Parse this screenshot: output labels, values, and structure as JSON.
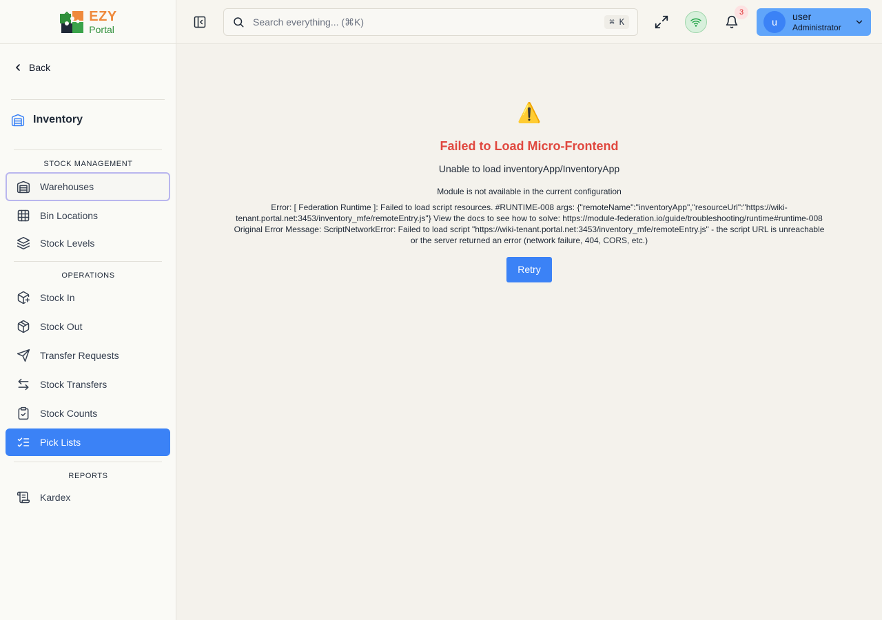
{
  "brand": {
    "line1": "EZY",
    "line2": "Portal"
  },
  "sidebar": {
    "back_label": "Back",
    "module_title": "Inventory",
    "sections": [
      {
        "header": "STOCK MANAGEMENT",
        "items": [
          {
            "label": "Warehouses",
            "icon": "warehouse-icon"
          },
          {
            "label": "Bin Locations",
            "icon": "grid-icon"
          },
          {
            "label": "Stock Levels",
            "icon": "layers-icon"
          }
        ]
      },
      {
        "header": "OPERATIONS",
        "items": [
          {
            "label": "Stock In",
            "icon": "package-plus-icon"
          },
          {
            "label": "Stock Out",
            "icon": "package-minus-icon"
          },
          {
            "label": "Transfer Requests",
            "icon": "send-icon"
          },
          {
            "label": "Stock Transfers",
            "icon": "arrows-left-right-icon"
          },
          {
            "label": "Stock Counts",
            "icon": "clipboard-check-icon"
          },
          {
            "label": "Pick Lists",
            "icon": "list-checks-icon"
          }
        ]
      },
      {
        "header": "REPORTS",
        "items": [
          {
            "label": "Kardex",
            "icon": "scroll-icon"
          }
        ]
      }
    ],
    "active_item": "Pick Lists",
    "focused_item": "Warehouses"
  },
  "header": {
    "search_placeholder": "Search everything... (⌘K)",
    "search_shortcut": "⌘ K",
    "notification_count": "3",
    "user": {
      "initial": "u",
      "name": "user",
      "role": "Administrator"
    }
  },
  "error": {
    "title": "Failed to Load Micro-Frontend",
    "subtitle": "Unable to load inventoryApp/InventoryApp",
    "module_message": "Module is not available in the current configuration",
    "details": "Error: [ Federation Runtime ]: Failed to load script resources. #RUNTIME-008 args: {\"remoteName\":\"inventoryApp\",\"resourceUrl\":\"https://wiki-tenant.portal.net:3453/inventory_mfe/remoteEntry.js\"} View the docs to see how to solve: https://module-federation.io/guide/troubleshooting/runtime#runtime-008 Original Error Message: ScriptNetworkError: Failed to load script \"https://wiki-tenant.portal.net:3453/inventory_mfe/remoteEntry.js\" - the script URL is unreachable or the server returned an error (network failure, 404, CORS, etc.)",
    "retry_label": "Retry"
  },
  "colors": {
    "accent": "#3b82f6",
    "error": "#e0483f",
    "brand_orange": "#ef8a3d",
    "brand_green": "#2f8f3a"
  }
}
